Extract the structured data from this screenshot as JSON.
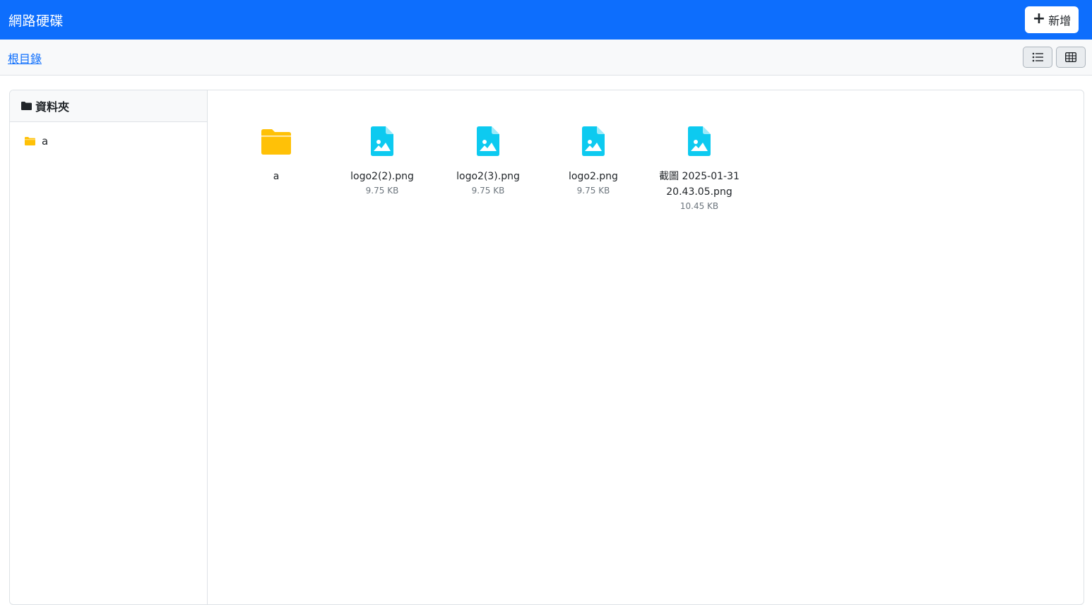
{
  "navbar": {
    "brand": "網路硬碟",
    "new_button_label": "新增",
    "new_button_icon": "plus-icon"
  },
  "toolbar": {
    "breadcrumb_root": "根目錄",
    "view_list_icon": "list-icon",
    "view_grid_icon": "grid-icon"
  },
  "sidebar": {
    "header_label": "資料夾",
    "header_icon": "folder-icon",
    "folders": [
      {
        "name": "a",
        "icon": "folder-icon"
      }
    ]
  },
  "files": [
    {
      "name": "a",
      "type": "folder",
      "size": ""
    },
    {
      "name": "logo2(2).png",
      "type": "image",
      "size": "9.75 KB"
    },
    {
      "name": "logo2(3).png",
      "type": "image",
      "size": "9.75 KB"
    },
    {
      "name": "logo2.png",
      "type": "image",
      "size": "9.75 KB"
    },
    {
      "name": "截圖 2025-01-31 20.43.05.png",
      "type": "image",
      "size": "10.45 KB"
    }
  ],
  "colors": {
    "primary": "#0d6efd",
    "folder": "#ffc107",
    "image_file": "#0dcaf0"
  }
}
